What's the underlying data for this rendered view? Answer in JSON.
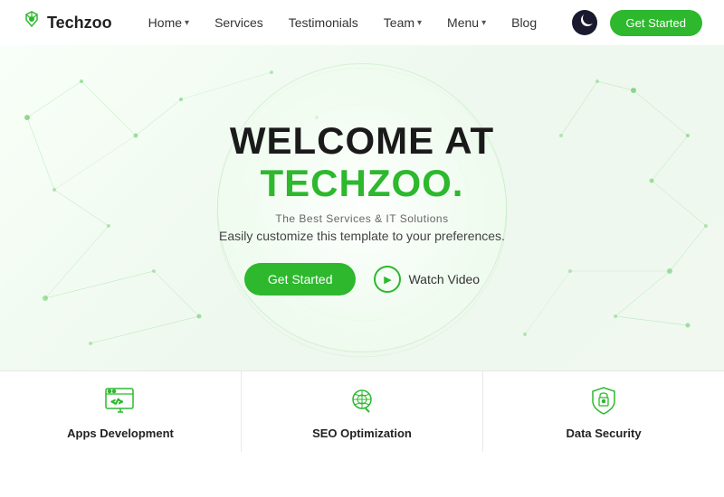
{
  "brand": {
    "logo_text": "Techzoo",
    "logo_icon": "🐾"
  },
  "navbar": {
    "links": [
      {
        "label": "Home",
        "has_dropdown": true
      },
      {
        "label": "Services",
        "has_dropdown": false
      },
      {
        "label": "Testimonials",
        "has_dropdown": false
      },
      {
        "label": "Team",
        "has_dropdown": true
      },
      {
        "label": "Menu",
        "has_dropdown": true
      },
      {
        "label": "Blog",
        "has_dropdown": false
      }
    ],
    "cta_label": "Get Started"
  },
  "hero": {
    "title_line1": "WELCOME AT",
    "title_line2": "TECHZOO.",
    "subtitle": "The Best Services & IT Solutions",
    "description": "Easily customize this template to your preferences.",
    "btn_start": "Get Started",
    "btn_video": "Watch Video"
  },
  "cards": [
    {
      "label": "Apps Development",
      "icon": "apps"
    },
    {
      "label": "SEO Optimization",
      "icon": "seo"
    },
    {
      "label": "Data Security",
      "icon": "security"
    }
  ]
}
